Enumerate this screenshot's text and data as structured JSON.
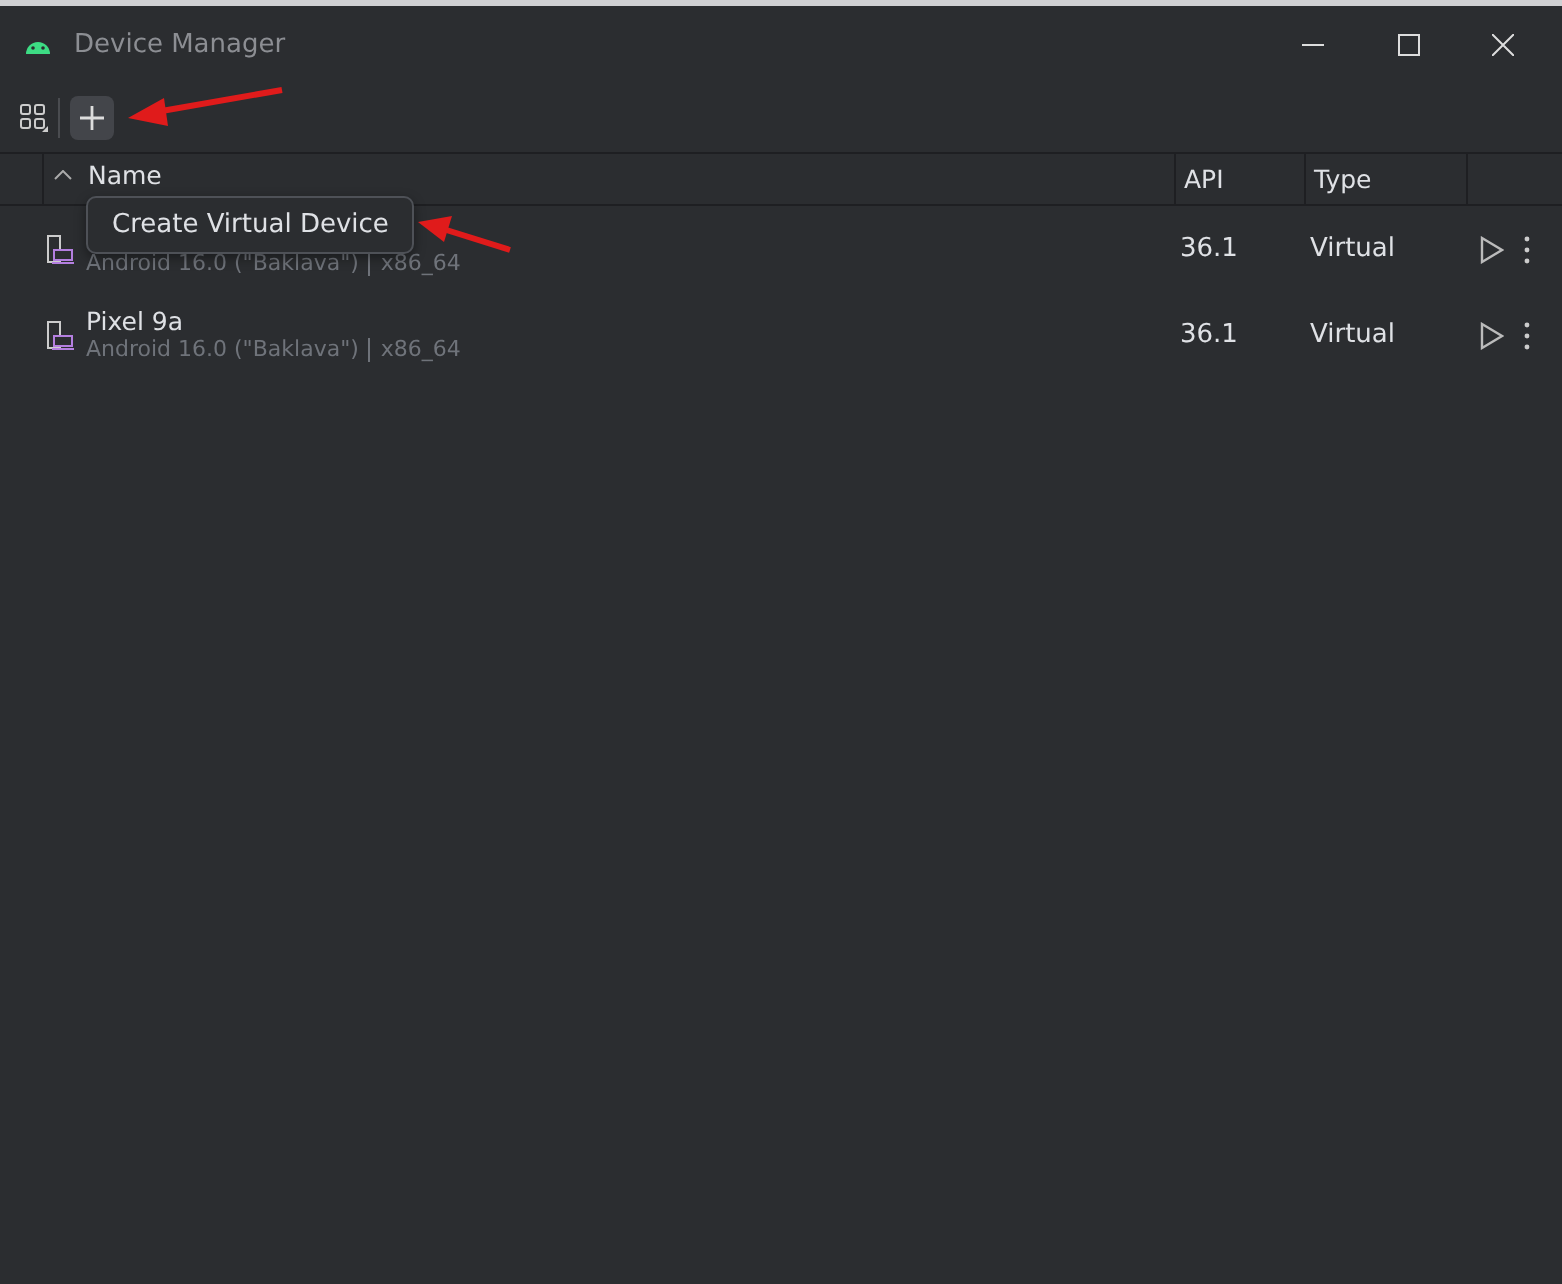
{
  "window": {
    "title": "Device Manager"
  },
  "toolbar": {
    "tooltip": "Create Virtual Device"
  },
  "table": {
    "columns": [
      "Name",
      "API",
      "Type"
    ],
    "rows": [
      {
        "name": "",
        "subtitle": "Android 16.0 (\"Baklava\")",
        "abi": "x86_64",
        "api": "36.1",
        "type": "Virtual"
      },
      {
        "name": "Pixel 9a",
        "subtitle": "Android 16.0 (\"Baklava\")",
        "abi": "x86_64",
        "api": "36.1",
        "type": "Virtual"
      }
    ]
  }
}
